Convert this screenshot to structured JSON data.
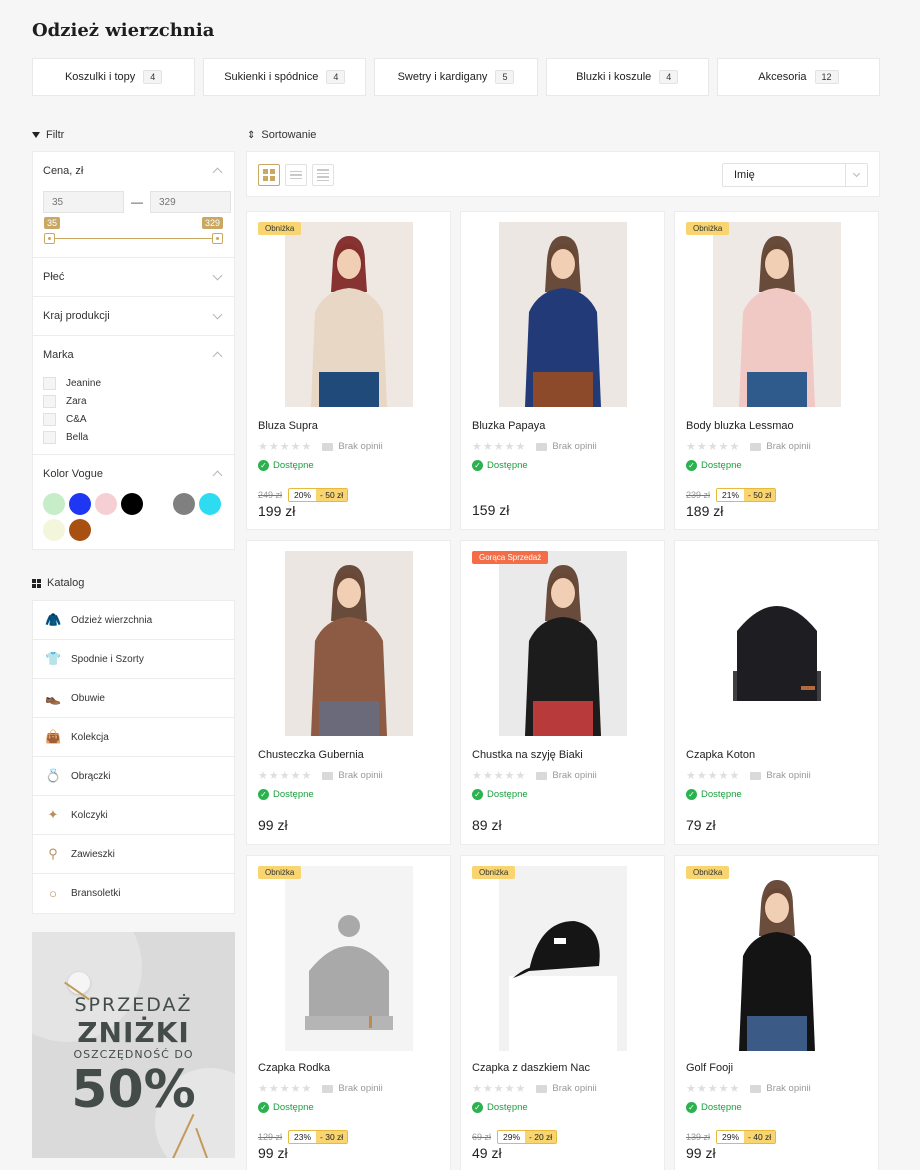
{
  "page": {
    "title": "Odzież wierzchnia"
  },
  "categories": [
    {
      "label": "Koszulki i topy",
      "count": "4"
    },
    {
      "label": "Sukienki i spódnice",
      "count": "4"
    },
    {
      "label": "Swetry i kardigany",
      "count": "5"
    },
    {
      "label": "Bluzki i koszule",
      "count": "4"
    },
    {
      "label": "Akcesoria",
      "count": "12"
    }
  ],
  "filter": {
    "header": "Filtr",
    "price": {
      "title": "Cena, zł",
      "min_placeholder": "35",
      "max_placeholder": "329",
      "min_tag": "35",
      "max_tag": "329",
      "dash": "—"
    },
    "gender": {
      "title": "Płeć"
    },
    "country": {
      "title": "Kraj produkcji"
    },
    "brand": {
      "title": "Marka",
      "items": [
        "Jeanine",
        "Zara",
        "C&A",
        "Bella"
      ]
    },
    "color": {
      "title": "Kolor Vogue",
      "swatches": [
        "#c6ecc8",
        "#1f36f2",
        "#f5cfd3",
        "#000000",
        "#ffffff",
        "#808080",
        "#2ddcf0",
        "#f4f6dc",
        "#a84f12"
      ]
    }
  },
  "catalog": {
    "header": "Katalog",
    "items": [
      {
        "label": "Odzież wierzchnia",
        "icon": "jacket-icon",
        "glyph": "🧥"
      },
      {
        "label": "Spodnie i Szorty",
        "icon": "shirt-icon",
        "glyph": "👕"
      },
      {
        "label": "Obuwie",
        "icon": "shoe-icon",
        "glyph": "👞"
      },
      {
        "label": "Kolekcja",
        "icon": "bag-icon",
        "glyph": "👜"
      },
      {
        "label": "Obrączki",
        "icon": "ring-icon",
        "glyph": "💍"
      },
      {
        "label": "Kolczyki",
        "icon": "earrings-icon",
        "glyph": "✦"
      },
      {
        "label": "Zawieszki",
        "icon": "pendant-icon",
        "glyph": "⚲"
      },
      {
        "label": "Bransoletki",
        "icon": "bracelet-icon",
        "glyph": "○"
      }
    ]
  },
  "promo": {
    "line1": "SPRZEDAŻ",
    "line2": "ZNIŻKI",
    "line3": "OSZCZĘDNOŚĆ DO",
    "line4": "50%"
  },
  "sort": {
    "header": "Sortowanie",
    "selected": "Imię"
  },
  "product_common": {
    "no_reviews": "Brak opinii",
    "available": "Dostępne"
  },
  "products": [
    {
      "name": "Bluza Supra",
      "badge": "Obniżka",
      "old_price": "249 zł",
      "pct": "20%",
      "amt": "- 50 zł",
      "price": "199 zł",
      "colors": {
        "bg": "#efe8e2",
        "main": "#e8d7c5",
        "accent": "#1f4a7a"
      }
    },
    {
      "name": "Bluzka Papaya",
      "badge": "",
      "old_price": "",
      "pct": "",
      "amt": "",
      "price": "159 zł",
      "colors": {
        "bg": "#ece7e2",
        "main": "#233a78",
        "accent": "#8c4a2a"
      }
    },
    {
      "name": "Body bluzka Lessmao",
      "badge": "Obniżka",
      "old_price": "239 zł",
      "pct": "21%",
      "amt": "- 50 zł",
      "price": "189 zł",
      "colors": {
        "bg": "#efe9e6",
        "main": "#f0c8c4",
        "accent": "#2f5a8c"
      }
    },
    {
      "name": "Chusteczka Gubernia",
      "badge": "",
      "old_price": "",
      "pct": "",
      "amt": "",
      "price": "99 zł",
      "colors": {
        "bg": "#ebe6e2",
        "main": "#8d5a44",
        "accent": "#6a6a7a"
      }
    },
    {
      "name": "Chustka na szyję Biaki",
      "badge": "Gorąca Sprzedaż",
      "old_price": "",
      "pct": "",
      "amt": "",
      "price": "89 zł",
      "colors": {
        "bg": "#eaeaea",
        "main": "#1c1c1c",
        "accent": "#b83a3a"
      }
    },
    {
      "name": "Czapka Koton",
      "badge": "",
      "old_price": "",
      "pct": "",
      "amt": "",
      "price": "79 zł",
      "colors": {
        "bg": "#ffffff",
        "main": "#1d1d22",
        "accent": "#b26b3a"
      }
    },
    {
      "name": "Czapka Rodka",
      "badge": "Obniżka",
      "old_price": "129 zł",
      "pct": "23%",
      "amt": "- 30 zł",
      "price": "99 zł",
      "colors": {
        "bg": "#f4f4f4",
        "main": "#a9a9a9",
        "accent": "#c08a4a"
      }
    },
    {
      "name": "Czapka z daszkiem Nac",
      "badge": "Obniżka",
      "old_price": "69 zł",
      "pct": "29%",
      "amt": "- 20 zł",
      "price": "49 zł",
      "colors": {
        "bg": "#f2f2f2",
        "main": "#151515",
        "accent": "#ffffff"
      }
    },
    {
      "name": "Golf Fooji",
      "badge": "Obniżka",
      "old_price": "139 zł",
      "pct": "29%",
      "amt": "- 40 zł",
      "price": "99 zł",
      "colors": {
        "bg": "#ffffff",
        "main": "#141414",
        "accent": "#3b5a86"
      }
    }
  ]
}
